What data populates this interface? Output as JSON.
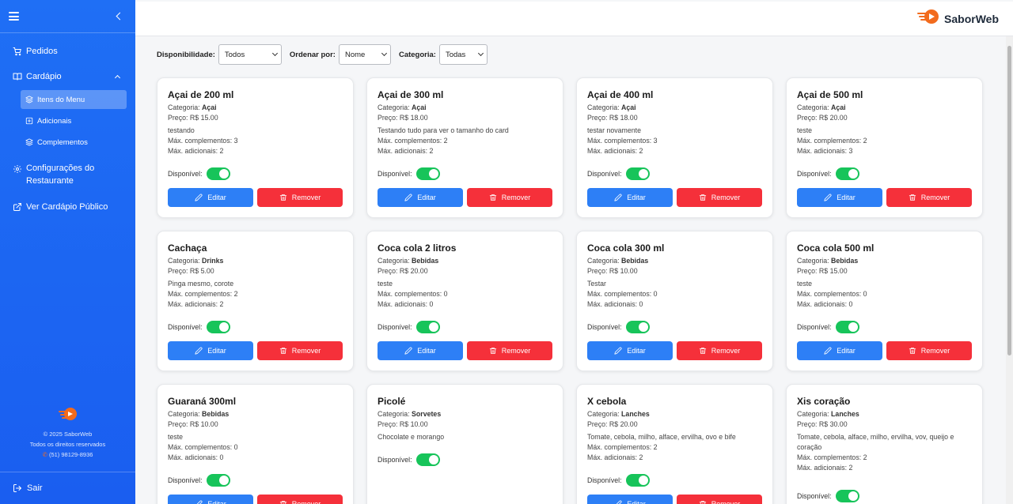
{
  "sidebar": {
    "nav": {
      "pedidos": "Pedidos",
      "cardapio": "Cardápio",
      "itens_menu": "Itens do Menu",
      "adicionais": "Adicionais",
      "complementos": "Complementos",
      "config_line1": "Configurações do",
      "config_line2": "Restaurante",
      "publico": "Ver Cardápio Público"
    },
    "footer": {
      "copyright": "© 2025 SaborWeb",
      "rights": "Todos os direitos reservados",
      "phone": "(51) 98129-8936"
    },
    "logout": "Sair"
  },
  "header": {
    "brand": "SaborWeb"
  },
  "filters": {
    "availability_label": "Disponibilidade:",
    "availability_value": "Todos",
    "order_label": "Ordenar por:",
    "order_value": "Nome",
    "category_label": "Categoria:",
    "category_value": "Todas"
  },
  "labels": {
    "category": "Categoria:",
    "price": "Preço:",
    "max_complements": "Máx. complementos:",
    "max_additions": "Máx. adicionais:",
    "available": "Disponível:",
    "edit": "Editar",
    "remove": "Remover"
  },
  "items": [
    {
      "name": "Açai de 200 ml",
      "category": "Açai",
      "price": "R$ 15.00",
      "desc": "testando",
      "max_comp": "3",
      "max_add": "2"
    },
    {
      "name": "Açai de 300 ml",
      "category": "Açai",
      "price": "R$ 18.00",
      "desc": "Testando tudo para ver o tamanho do card",
      "max_comp": "2",
      "max_add": "2"
    },
    {
      "name": "Açai de 400 ml",
      "category": "Açai",
      "price": "R$ 18.00",
      "desc": "testar novamente",
      "max_comp": "3",
      "max_add": "2"
    },
    {
      "name": "Açai de 500 ml",
      "category": "Açai",
      "price": "R$ 20.00",
      "desc": "teste",
      "max_comp": "2",
      "max_add": "3"
    },
    {
      "name": "Cachaça",
      "category": "Drinks",
      "price": "R$ 5.00",
      "desc": "Pinga mesmo, corote",
      "max_comp": "2",
      "max_add": "2"
    },
    {
      "name": "Coca cola 2 litros",
      "category": "Bebidas",
      "price": "R$ 20.00",
      "desc": "teste",
      "max_comp": "0",
      "max_add": "0"
    },
    {
      "name": "Coca cola 300 ml",
      "category": "Bebidas",
      "price": "R$ 10.00",
      "desc": "Testar",
      "max_comp": "0",
      "max_add": "0"
    },
    {
      "name": "Coca cola 500 ml",
      "category": "Bebidas",
      "price": "R$ 15.00",
      "desc": "teste",
      "max_comp": "0",
      "max_add": "0"
    },
    {
      "name": "Guaraná 300ml",
      "category": "Bebidas",
      "price": "R$ 10.00",
      "desc": "teste",
      "max_comp": "0",
      "max_add": "0"
    },
    {
      "name": "Picolé",
      "category": "Sorvetes",
      "price": "R$ 10.00",
      "desc": "Chocolate e morango",
      "max_comp": null,
      "max_add": null
    },
    {
      "name": "X cebola",
      "category": "Lanches",
      "price": "R$ 20.00",
      "desc": "Tomate, cebola, milho, alface, ervilha, ovo e bife",
      "max_comp": "2",
      "max_add": "2"
    },
    {
      "name": "Xis coração",
      "category": "Lanches",
      "price": "R$ 30.00",
      "desc": "Tomate, cebola, alface, milho, ervilha, vov, queijo e coração",
      "max_comp": "2",
      "max_add": "2"
    }
  ],
  "colors": {
    "sidebar": "#1f6ff5",
    "edit": "#2d7ff6",
    "remove": "#f5303a",
    "toggle_on": "#17c45a",
    "brand_orange": "#f26b1d"
  }
}
